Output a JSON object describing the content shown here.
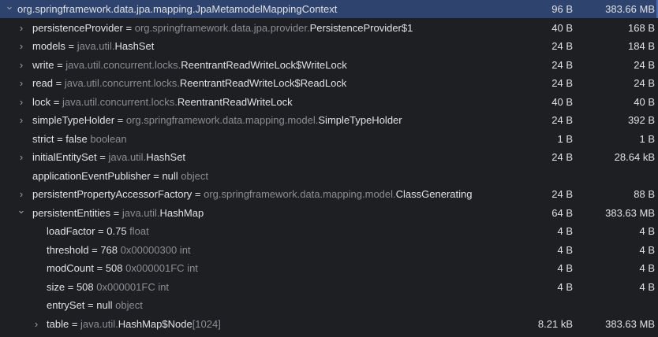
{
  "rows": [
    {
      "expander": "down",
      "selected": true,
      "name": "org.springframework.data.jpa.mapping.JpaMetamodelMappingContext",
      "eq": "",
      "pkg": "",
      "cls": "",
      "hint": "",
      "shallow": "96 B",
      "retained": "383.66 MB"
    },
    {
      "expander": "right",
      "name": "persistenceProvider",
      "eq": " = ",
      "pkg": "org.springframework.data.jpa.provider.",
      "cls": "PersistenceProvider$1",
      "hint": "",
      "shallow": "40 B",
      "retained": "168 B"
    },
    {
      "expander": "right",
      "name": "models",
      "eq": " = ",
      "pkg": "java.util.",
      "cls": "HashSet",
      "hint": "",
      "shallow": "24 B",
      "retained": "184 B"
    },
    {
      "expander": "right",
      "name": "write",
      "eq": " = ",
      "pkg": "java.util.concurrent.locks.",
      "cls": "ReentrantReadWriteLock$WriteLock",
      "hint": "",
      "shallow": "24 B",
      "retained": "24 B"
    },
    {
      "expander": "right",
      "name": "read",
      "eq": " = ",
      "pkg": "java.util.concurrent.locks.",
      "cls": "ReentrantReadWriteLock$ReadLock",
      "hint": "",
      "shallow": "24 B",
      "retained": "24 B"
    },
    {
      "expander": "right",
      "name": "lock",
      "eq": " = ",
      "pkg": "java.util.concurrent.locks.",
      "cls": "ReentrantReadWriteLock",
      "hint": "",
      "shallow": "40 B",
      "retained": "40 B"
    },
    {
      "expander": "right",
      "name": "simpleTypeHolder",
      "eq": " = ",
      "pkg": "org.springframework.data.mapping.model.",
      "cls": "SimpleTypeHolder",
      "hint": "",
      "shallow": "24 B",
      "retained": "392 B"
    },
    {
      "expander": "none",
      "name": "strict",
      "eq": " = ",
      "pkg": "",
      "cls": "false",
      "hint": " boolean",
      "shallow": "1 B",
      "retained": "1 B"
    },
    {
      "expander": "right",
      "name": "initialEntitySet",
      "eq": " = ",
      "pkg": "java.util.",
      "cls": "HashSet",
      "hint": "",
      "shallow": "24 B",
      "retained": "28.64 kB"
    },
    {
      "expander": "none",
      "name": "applicationEventPublisher",
      "eq": " = ",
      "pkg": "",
      "cls": "null",
      "hint": " object",
      "shallow": "",
      "retained": ""
    },
    {
      "expander": "right",
      "name": "persistentPropertyAccessorFactory",
      "eq": " = ",
      "pkg": "org.springframework.data.mapping.model.",
      "cls": "ClassGenerating",
      "hint": "",
      "shallow": "24 B",
      "retained": "88 B"
    },
    {
      "expander": "down",
      "name": "persistentEntities",
      "eq": " = ",
      "pkg": "java.util.",
      "cls": "HashMap",
      "hint": "",
      "shallow": "64 B",
      "retained": "383.63 MB"
    },
    {
      "expander": "none",
      "depth": 2,
      "name": "loadFactor",
      "eq": " = ",
      "pkg": "",
      "cls": "0.75",
      "hint": " float",
      "shallow": "4 B",
      "retained": "4 B"
    },
    {
      "expander": "none",
      "depth": 2,
      "name": "threshold",
      "eq": " = ",
      "pkg": "",
      "cls": "768",
      "hint": " 0x00000300  int",
      "shallow": "4 B",
      "retained": "4 B"
    },
    {
      "expander": "none",
      "depth": 2,
      "name": "modCount",
      "eq": " = ",
      "pkg": "",
      "cls": "508",
      "hint": " 0x000001FC  int",
      "shallow": "4 B",
      "retained": "4 B"
    },
    {
      "expander": "none",
      "depth": 2,
      "name": "size",
      "eq": " = ",
      "pkg": "",
      "cls": "508",
      "hint": " 0x000001FC  int",
      "shallow": "4 B",
      "retained": "4 B"
    },
    {
      "expander": "none",
      "depth": 2,
      "name": "entrySet",
      "eq": " = ",
      "pkg": "",
      "cls": "null",
      "hint": " object",
      "shallow": "",
      "retained": ""
    },
    {
      "expander": "right",
      "depth": 2,
      "name": "table",
      "eq": " = ",
      "pkg": "java.util.",
      "cls": "HashMap$Node",
      "hint": "[1024]",
      "shallow": "8.21 kB",
      "retained": "383.63 MB"
    }
  ]
}
